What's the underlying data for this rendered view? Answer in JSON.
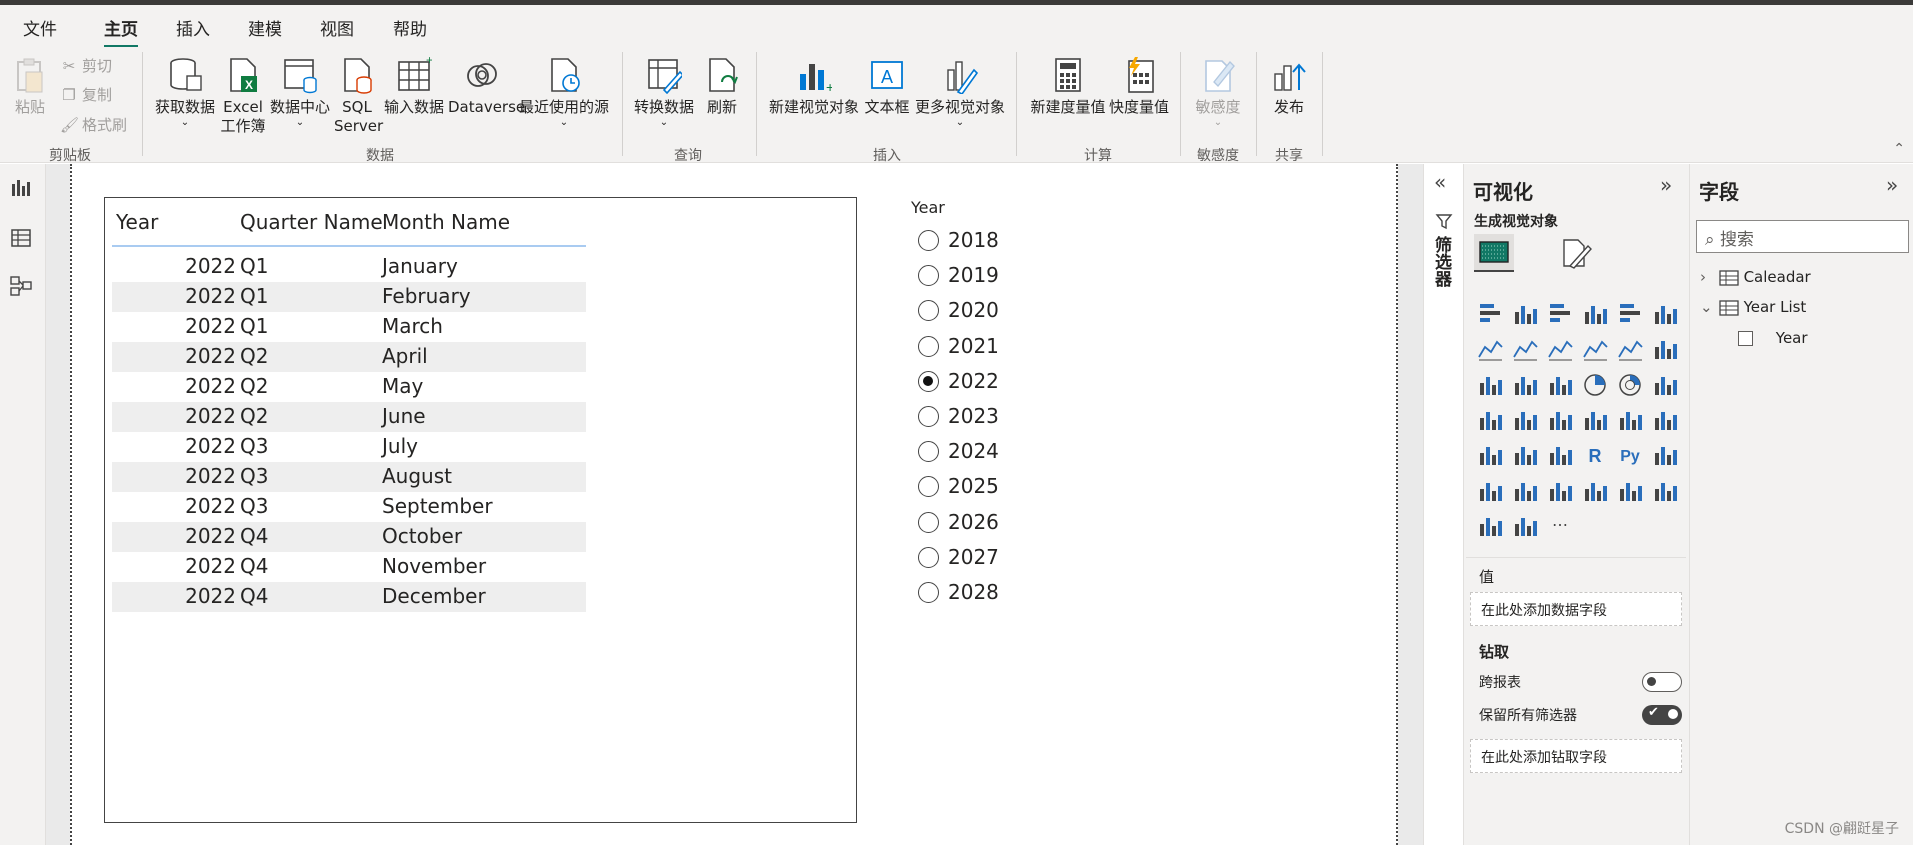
{
  "menu": {
    "file": "文件",
    "home": "主页",
    "insert": "插入",
    "modeling": "建模",
    "view": "视图",
    "help": "帮助"
  },
  "ribbon": {
    "clipboard": {
      "paste": "粘贴",
      "cut": "剪切",
      "copy": "复制",
      "format_painter": "格式刷",
      "group": "剪贴板"
    },
    "data": {
      "get_data": "获取数据",
      "excel_line1": "Excel",
      "excel_line2": "工作簿",
      "data_hub": "数据中心",
      "sql_line1": "SQL",
      "sql_line2": "Server",
      "enter_data": "输入数据",
      "dataverse": "Dataverse",
      "recent_sources": "最近使用的源",
      "group": "数据"
    },
    "queries": {
      "transform": "转换数据",
      "refresh": "刷新",
      "group": "查询"
    },
    "insert": {
      "new_visual": "新建视觉对象",
      "text_box": "文本框",
      "more_visuals": "更多视觉对象",
      "group": "插入"
    },
    "calculations": {
      "new_measure": "新建度量值",
      "quick_measure": "快度量值",
      "group": "计算"
    },
    "sensitivity": {
      "label": "敏感度",
      "group": "敏感度"
    },
    "share": {
      "publish": "发布",
      "group": "共享"
    }
  },
  "table_visual": {
    "headers": [
      "Year",
      "Quarter Name",
      "Month Name"
    ],
    "rows": [
      [
        "2022",
        "Q1",
        "January"
      ],
      [
        "2022",
        "Q1",
        "February"
      ],
      [
        "2022",
        "Q1",
        "March"
      ],
      [
        "2022",
        "Q2",
        "April"
      ],
      [
        "2022",
        "Q2",
        "May"
      ],
      [
        "2022",
        "Q2",
        "June"
      ],
      [
        "2022",
        "Q3",
        "July"
      ],
      [
        "2022",
        "Q3",
        "August"
      ],
      [
        "2022",
        "Q3",
        "September"
      ],
      [
        "2022",
        "Q4",
        "October"
      ],
      [
        "2022",
        "Q4",
        "November"
      ],
      [
        "2022",
        "Q4",
        "December"
      ]
    ]
  },
  "slicer": {
    "title": "Year",
    "options": [
      "2018",
      "2019",
      "2020",
      "2021",
      "2022",
      "2023",
      "2024",
      "2025",
      "2026",
      "2027",
      "2028"
    ],
    "selected": "2022"
  },
  "filters": {
    "label": "筛选器"
  },
  "visualizations": {
    "title": "可视化",
    "subtitle": "生成视觉对象",
    "values_section": "值",
    "values_well": "在此处添加数据字段",
    "drill_section": "钻取",
    "cross_report": "跨报表",
    "cross_report_on": false,
    "keep_filters": "保留所有筛选器",
    "keep_filters_on": true,
    "drill_well": "在此处添加钻取字段"
  },
  "fields": {
    "title": "字段",
    "search_placeholder": "搜索",
    "tables": [
      {
        "name": "Caleadar",
        "expanded": false
      },
      {
        "name": "Year List",
        "expanded": true,
        "columns": [
          "Year"
        ]
      }
    ]
  },
  "watermark": "CSDN @翩跹星子",
  "colors": {
    "accent": "#117865",
    "table_header_line": "#a9cbf1",
    "alt_row": "#eeeeee"
  }
}
